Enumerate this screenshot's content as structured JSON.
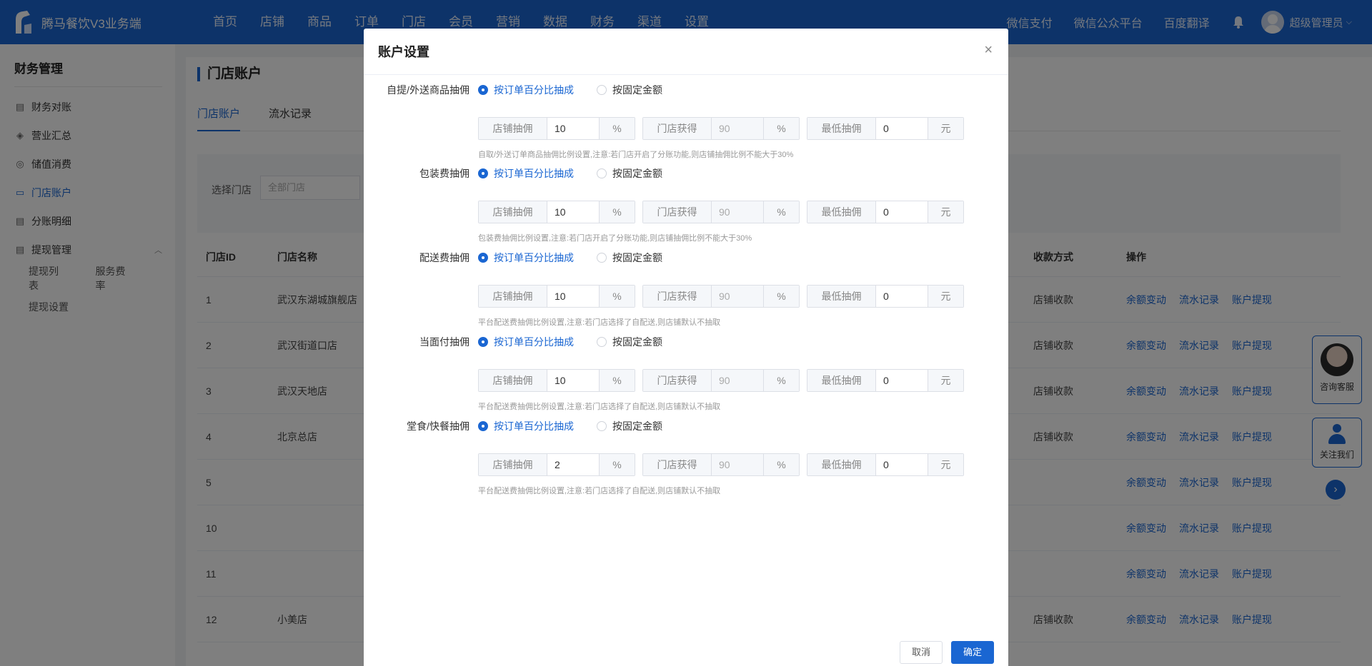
{
  "brand": {
    "title": "腾马餐饮V3业务端"
  },
  "nav": {
    "items": [
      "首页",
      "店铺",
      "商品",
      "订单",
      "门店",
      "会员",
      "营销",
      "数据",
      "财务",
      "渠道",
      "设置"
    ]
  },
  "nav_right": {
    "links": [
      "微信支付",
      "微信公众平台",
      "百度翻译"
    ],
    "user": "超级管理员"
  },
  "sidebar": {
    "title": "财务管理",
    "items": [
      {
        "label": "财务对账",
        "icon": "reconcile-icon"
      },
      {
        "label": "营业汇总",
        "icon": "layers-icon"
      },
      {
        "label": "储值消费",
        "icon": "coin-icon"
      },
      {
        "label": "门店账户",
        "icon": "card-icon"
      },
      {
        "label": "分账明细",
        "icon": "ledger-icon"
      },
      {
        "label": "提现管理",
        "icon": "withdraw-icon"
      }
    ],
    "sub": [
      "提现列表",
      "服务费率",
      "提现设置"
    ]
  },
  "main": {
    "title": "门店账户",
    "tabs": [
      "门店账户",
      "流水记录"
    ],
    "filter_label": "选择门店",
    "filter_placeholder": "全部门店",
    "headers": {
      "id": "门店ID",
      "name": "门店名称",
      "pay": "收款方式",
      "ops": "操作"
    },
    "rows": [
      {
        "id": "1",
        "name": "武汉东湖城旗舰店",
        "pay": "店铺收款"
      },
      {
        "id": "2",
        "name": "武汉街道口店",
        "pay": "店铺收款"
      },
      {
        "id": "3",
        "name": "武汉天地店",
        "pay": "店铺收款"
      },
      {
        "id": "4",
        "name": "北京总店",
        "pay": "店铺收款"
      },
      {
        "id": "5",
        "name": "",
        "pay": ""
      },
      {
        "id": "10",
        "name": "",
        "pay": ""
      },
      {
        "id": "11",
        "name": "",
        "pay": ""
      },
      {
        "id": "12",
        "name": "小美店",
        "pay": "店铺收款"
      }
    ],
    "ops": [
      "余额变动",
      "流水记录",
      "账户提现"
    ]
  },
  "float": {
    "consult": "咨询客服",
    "follow": "关注我们"
  },
  "modal": {
    "title": "账户设置",
    "cancel": "取消",
    "ok": "确定",
    "opt_percent": "按订单百分比抽成",
    "opt_fixed": "按固定金额",
    "pre_shop": "店铺抽佣",
    "pre_store": "门店获得",
    "pre_min": "最低抽佣",
    "unit_pct": "%",
    "unit_yuan": "元",
    "sections": [
      {
        "label": "自提/外送商品抽佣",
        "shop": "10",
        "store": "90",
        "min": "0",
        "hint": "自取/外送订单商品抽佣比例设置,注意:若门店开启了分账功能,则店铺抽佣比例不能大于30%"
      },
      {
        "label": "包装费抽佣",
        "shop": "10",
        "store": "90",
        "min": "0",
        "hint": "包装费抽佣比例设置,注意:若门店开启了分账功能,则店铺抽佣比例不能大于30%"
      },
      {
        "label": "配送费抽佣",
        "shop": "10",
        "store": "90",
        "min": "0",
        "hint": "平台配送费抽佣比例设置,注意:若门店选择了自配送,则店铺默认不抽取"
      },
      {
        "label": "当面付抽佣",
        "shop": "10",
        "store": "90",
        "min": "0",
        "hint": "平台配送费抽佣比例设置,注意:若门店选择了自配送,则店铺默认不抽取"
      },
      {
        "label": "堂食/快餐抽佣",
        "shop": "2",
        "store": "90",
        "min": "0",
        "hint": "平台配送费抽佣比例设置,注意:若门店选择了自配送,则店铺默认不抽取"
      }
    ]
  }
}
